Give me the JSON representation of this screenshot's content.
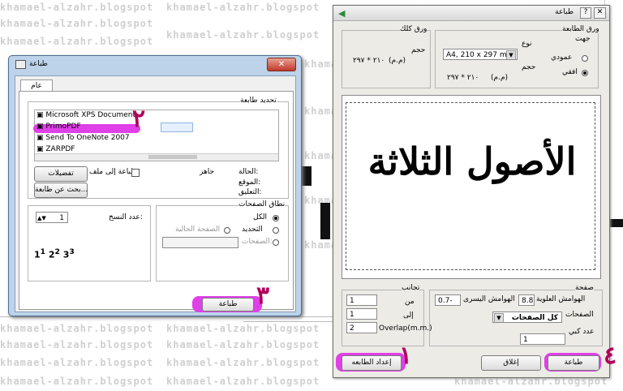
{
  "watermark": "khamael-alzahr.blogspot",
  "annotations": [
    "٢",
    "٣",
    "١",
    "٤"
  ],
  "left_dialog": {
    "title": "طباعة",
    "tab": "عام",
    "select_printer_label": "تحديد طابعة",
    "printers": [
      "Microsoft XPS Document",
      "PrimoPDF",
      "Send To OneNote 2007",
      "ZARPDF"
    ],
    "status_label": "الحالة:",
    "status_value": "جاهز",
    "location_label": "الموقع:",
    "comment_label": "التعليق:",
    "print_to_file": "طباعة إلى ملف",
    "preferences_button": "تفضيلات",
    "find_printer_button": "بحث عن طابعة...",
    "page_range_label": "نطاق الصفحات",
    "range_all": "الكل",
    "range_selection": "التحديد",
    "range_current": "الصفحة الحالية",
    "range_pages": "الصفحات:",
    "copies_label": "عدد النسخ:",
    "copies_value": "1",
    "collate_pages": [
      "1",
      "1",
      "2",
      "2",
      "3",
      "3"
    ],
    "print_button": "طباعة"
  },
  "right_dialog": {
    "title": "طباعة",
    "paper_group_label": "ورق الطابعة",
    "orientation_label": "جهت",
    "portrait": "عمودي",
    "landscape": "افقي",
    "type_label": "نوع",
    "paper_type_value": "A4, 210 x 297 mm",
    "size_label": "حجم",
    "size_unit": "(م.م)",
    "size_value": "٢١٠ * ٢٩٧",
    "doc_paper_group_label": "ورق كلك",
    "doc_size_label": "حجم",
    "doc_size_unit": "(م.م)",
    "doc_size_value": "٢١٠ * ٢٩٧",
    "preview_text": "الأصول الثلاثة",
    "page_group_label": "صفحة",
    "top_margin_label": "الهوامش العلوية",
    "top_margin_value": "8.8",
    "right_margin_label": "الهوامش اليسرى",
    "right_margin_value": "0.7-",
    "pages_label": "الصفحات",
    "pages_value": "كل الصفحات",
    "copies_label": "عدد كبي",
    "copies_value": "1",
    "overlap_group_label": "تجانب",
    "from_label": "من",
    "from_value": "1",
    "to_label": "إلى",
    "to_value": "1",
    "overlap_label": "Overlap(m.m.)",
    "overlap_value": "2",
    "setup_button": "إعداد الطابعه",
    "close_button": "إغلاق",
    "print_button": "طباعة"
  }
}
